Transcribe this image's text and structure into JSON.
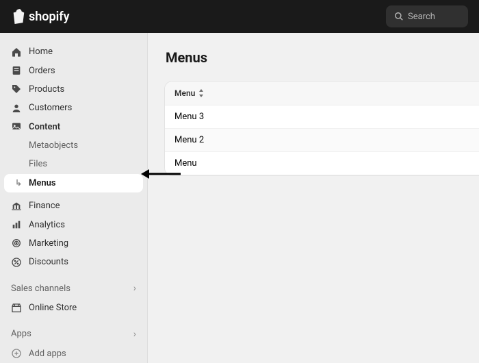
{
  "brand": "shopify",
  "search": {
    "placeholder": "Search"
  },
  "sidebar": {
    "items": [
      {
        "label": "Home"
      },
      {
        "label": "Orders"
      },
      {
        "label": "Products"
      },
      {
        "label": "Customers"
      },
      {
        "label": "Content"
      },
      {
        "label": "Finance"
      },
      {
        "label": "Analytics"
      },
      {
        "label": "Marketing"
      },
      {
        "label": "Discounts"
      }
    ],
    "content_sub": [
      {
        "label": "Metaobjects"
      },
      {
        "label": "Files"
      },
      {
        "label": "Menus"
      }
    ],
    "sections": {
      "sales_channels": "Sales channels",
      "apps": "Apps"
    },
    "online_store": "Online Store",
    "add_apps": "Add apps"
  },
  "page": {
    "title": "Menus",
    "column_header": "Menu",
    "rows": [
      {
        "label": "Menu 3"
      },
      {
        "label": "Menu 2"
      },
      {
        "label": "Menu"
      }
    ]
  }
}
